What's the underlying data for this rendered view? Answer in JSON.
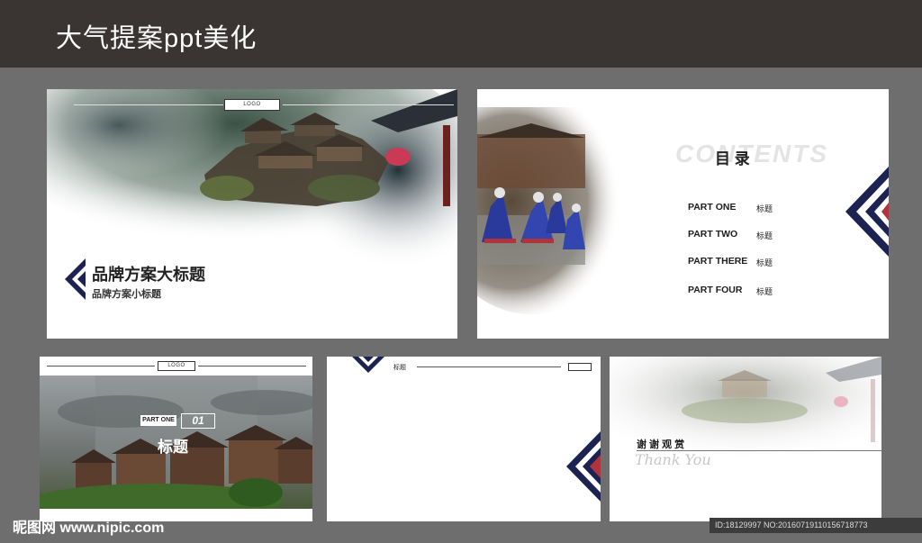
{
  "banner": {
    "title": "大气提案ppt美化"
  },
  "slide1": {
    "logo": "LOGO",
    "title": "品牌方案大标题",
    "subtitle": "品牌方案小标题"
  },
  "slide2": {
    "bg_word": "CONTENTS",
    "heading": "目 录",
    "toc": [
      {
        "part": "PART ONE",
        "label": "标题"
      },
      {
        "part": "PART TWO",
        "label": "标题"
      },
      {
        "part": "PART THERE",
        "label": "标题"
      },
      {
        "part": "PART FOUR",
        "label": "标题"
      }
    ]
  },
  "slide3": {
    "logo": "LOGO",
    "part_label": "PART ONE",
    "number": "01",
    "title": "标题"
  },
  "slide4": {
    "header_label": "标题"
  },
  "slide5": {
    "thanks_cn": "谢 谢 观 赏",
    "thanks_en": "Thank You"
  },
  "watermark": {
    "site": "昵图网 www.nipic.com",
    "id_text": "ID:18129997 NO:20160719110156718773"
  },
  "colors": {
    "banner_bg": "#3a3432",
    "page_bg": "#6f6e6e",
    "accent_navy": "#1c2350",
    "accent_red": "#b0343e"
  }
}
